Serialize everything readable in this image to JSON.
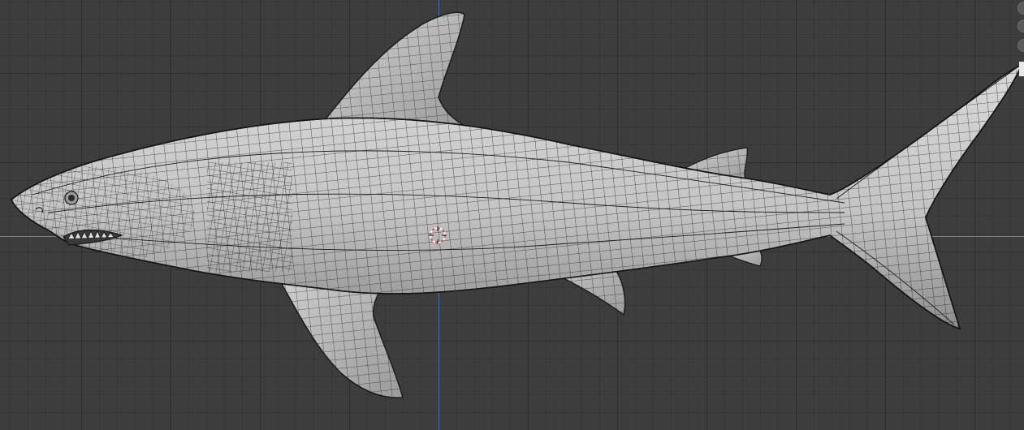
{
  "viewport": {
    "background_color": "#3d3d3d",
    "grid_color": "#353535",
    "axis_x_color": "#6a8f2e",
    "axis_z_color": "#3f6eb0"
  },
  "mesh": {
    "object": "shark",
    "shading": "solid",
    "wireframe_overlay": true,
    "surface_color": "#bfbfbf",
    "wire_color": "#1a1a1a"
  },
  "cursor_3d": {
    "icon": "3d-cursor-icon",
    "ring_colors": [
      "#e05050",
      "#ffffff"
    ]
  },
  "gizmo_buttons": [
    {
      "icon": "zoom-icon"
    },
    {
      "icon": "pan-icon"
    },
    {
      "icon": "camera-icon"
    }
  ]
}
